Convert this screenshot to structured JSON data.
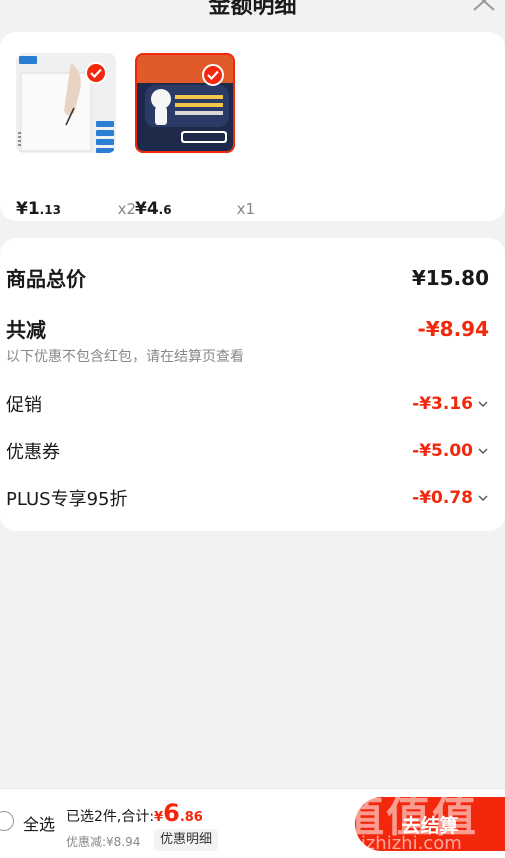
{
  "header": {
    "title": "金额明细"
  },
  "products": [
    {
      "price_int": "¥1",
      "price_dec": ".13",
      "qty": "x2",
      "selected": true
    },
    {
      "price_int": "¥4",
      "price_dec": ".6",
      "qty": "x1",
      "selected": true
    }
  ],
  "summary": {
    "total_label": "商品总价",
    "total_value": "¥15.80",
    "reduce_label": "共减",
    "reduce_value": "-¥8.94",
    "note": "以下优惠不包含红包，请在结算页查看",
    "items": [
      {
        "label": "促销",
        "value": "-¥3.16"
      },
      {
        "label": "优惠券",
        "value": "-¥5.00"
      },
      {
        "label": "PLUS专享95折",
        "value": "-¥0.78"
      }
    ]
  },
  "bottom": {
    "select_all": "全选",
    "selected_prefix": "已选2件,合计:",
    "total_yen": "¥",
    "total_int": "6",
    "total_dec": ".86",
    "discount_text": "优惠减:¥8.94",
    "detail_button": "优惠明细",
    "checkout_button": "去结算"
  },
  "watermark": {
    "glyphs": "值值值",
    "url": "zhizhizhi.com"
  },
  "colors": {
    "accent": "#f2270c",
    "background": "#f2f2f2",
    "muted": "#888888"
  }
}
